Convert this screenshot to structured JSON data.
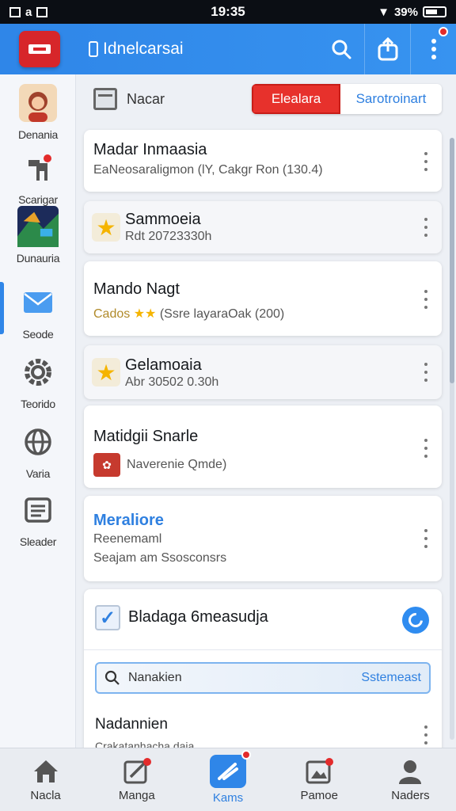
{
  "status_bar": {
    "left": "a",
    "time": "19:35",
    "battery": "39%"
  },
  "app_bar": {
    "title": "Idnelcarsai"
  },
  "sidebar": {
    "items": [
      {
        "label": "Denania",
        "icon": "avatar-icon"
      },
      {
        "label": "Scarigar",
        "icon": "dog-icon"
      },
      {
        "label": "Dunauria",
        "icon": "game-thumbnail-icon"
      },
      {
        "label": "Seode",
        "icon": "mail-icon"
      },
      {
        "label": "Teorido",
        "icon": "gear-icon"
      },
      {
        "label": "Varia",
        "icon": "globe-icon"
      },
      {
        "label": "Sleader",
        "icon": "document-icon"
      }
    ]
  },
  "topbar": {
    "label": "Nacar",
    "primary_btn": "Elealara",
    "secondary_btn": "Sarotroinart"
  },
  "cards": [
    {
      "title": "Madar Inmaasia",
      "sub": "EaNeosaraligmon (lY, Cakgr Ron (130.4)"
    },
    {
      "title": "Sammoeia",
      "sub": "Rdt 20723330h"
    },
    {
      "title": "Mando Nagt",
      "sub_prefix": "Cados",
      "sub": "(Ssre layaraOak (200)"
    },
    {
      "title": "Gelamoaia",
      "sub": "Abr 30502 0.30h"
    },
    {
      "title": "Matidgii Snarle",
      "sub": "Naverenie Qmde)"
    },
    {
      "title": "Meraliore",
      "line2": "Reenemaml",
      "line3": "Seajam am Ssosconsrs"
    }
  ],
  "task_card": {
    "title": "Bladaga 6measudja",
    "search_placeholder": "Nanakien",
    "search_action": "Sstemeast",
    "item_title": "Nadannien",
    "item_sub": "Crakatanhacha daia"
  },
  "bottom_nav": [
    {
      "label": "Nacla",
      "icon": "home-icon"
    },
    {
      "label": "Manga",
      "icon": "edit-icon"
    },
    {
      "label": "Kams",
      "icon": "feather-icon"
    },
    {
      "label": "Pamoe",
      "icon": "image-icon"
    },
    {
      "label": "Naders",
      "icon": "person-icon"
    }
  ],
  "colors": {
    "primary": "#2f86e8",
    "accent_red": "#e7312c",
    "star": "#f5b400"
  }
}
